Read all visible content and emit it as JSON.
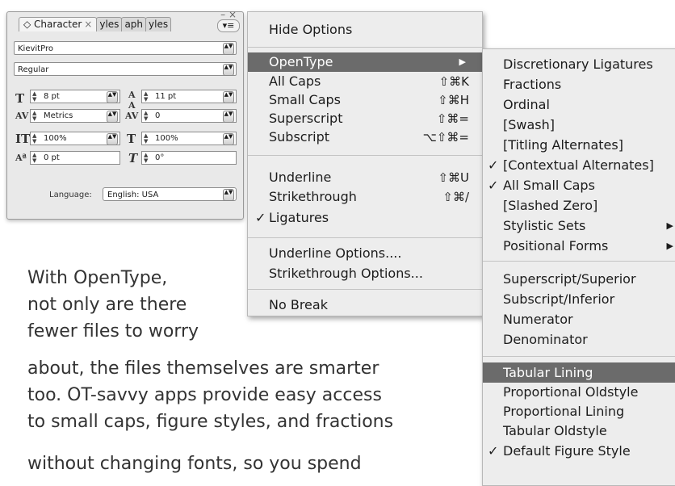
{
  "panel": {
    "tabs": [
      {
        "label": "◇ Character",
        "close": "×"
      },
      {
        "label": "yles"
      },
      {
        "label": "aph"
      },
      {
        "label": "yles"
      }
    ],
    "window_controls": "– ×",
    "menu_button": "▾≡",
    "font_family": "KievitPro",
    "font_style": "Regular",
    "size": "8 pt",
    "leading": "11 pt",
    "kerning": "Metrics",
    "tracking": "0",
    "vscale": "100%",
    "hscale": "100%",
    "baseline": "0 pt",
    "skew": "0°",
    "language_label": "Language:",
    "language_value": "English: USA"
  },
  "menu": {
    "items": [
      {
        "label": "Hide Options",
        "shortcut": ""
      },
      {
        "label": "OpenType",
        "shortcut": "",
        "submenu": true,
        "highlighted": true
      },
      {
        "label": "All Caps",
        "shortcut": "⇧⌘K"
      },
      {
        "label": "Small Caps",
        "shortcut": "⇧⌘H"
      },
      {
        "label": "Superscript",
        "shortcut": "⇧⌘="
      },
      {
        "label": "Subscript",
        "shortcut": "⌥⇧⌘="
      },
      {
        "label": "Underline",
        "shortcut": "⇧⌘U"
      },
      {
        "label": "Strikethrough",
        "shortcut": "⇧⌘/"
      },
      {
        "label": "Ligatures",
        "shortcut": "",
        "checked": true
      },
      {
        "label": "Underline Options....",
        "shortcut": ""
      },
      {
        "label": "Strikethrough Options...",
        "shortcut": ""
      },
      {
        "label": "No Break",
        "shortcut": ""
      }
    ]
  },
  "submenu": {
    "items": [
      {
        "label": "Discretionary Ligatures"
      },
      {
        "label": "Fractions"
      },
      {
        "label": "Ordinal"
      },
      {
        "label": "[Swash]"
      },
      {
        "label": "[Titling Alternates]"
      },
      {
        "label": "[Contextual Alternates]",
        "checked": true
      },
      {
        "label": "All Small Caps",
        "checked": true
      },
      {
        "label": "[Slashed Zero]"
      },
      {
        "label": "Stylistic Sets",
        "more": true
      },
      {
        "label": "Positional Forms",
        "more": true
      },
      {
        "label": "Superscript/Superior"
      },
      {
        "label": "Subscript/Inferior"
      },
      {
        "label": "Numerator"
      },
      {
        "label": "Denominator"
      },
      {
        "label": "Tabular Lining",
        "highlighted": true
      },
      {
        "label": "Proportional Oldstyle"
      },
      {
        "label": "Proportional Lining"
      },
      {
        "label": "Tabular Oldstyle"
      },
      {
        "label": "Default Figure Style",
        "checked": true
      }
    ]
  },
  "body_text": [
    "With OpenType,",
    "not only are there",
    "fewer files to worry",
    "about, the files themselves are smarter",
    "too. OT-savvy apps provide easy access",
    "to small caps, figure styles, and fractions",
    "without changing fonts, so you spend"
  ],
  "glyphs": {
    "check": "✓",
    "arrow": "▶",
    "stepper": "▲▼"
  }
}
